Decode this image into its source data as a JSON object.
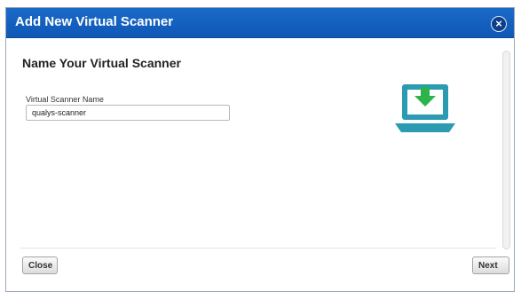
{
  "dialog": {
    "title": "Add New Virtual Scanner",
    "close_icon": "×"
  },
  "content": {
    "heading": "Name Your Virtual Scanner",
    "scanner_name_label": "Virtual Scanner Name",
    "scanner_name_value": "qualys-scanner",
    "illustration_icon": "laptop-download-icon"
  },
  "footer": {
    "close_label": "Close",
    "next_label": "Next"
  },
  "colors": {
    "titlebar": "#1565c8",
    "illustration_screen": "#2a9bb0",
    "illustration_arrow": "#2cb34a"
  }
}
